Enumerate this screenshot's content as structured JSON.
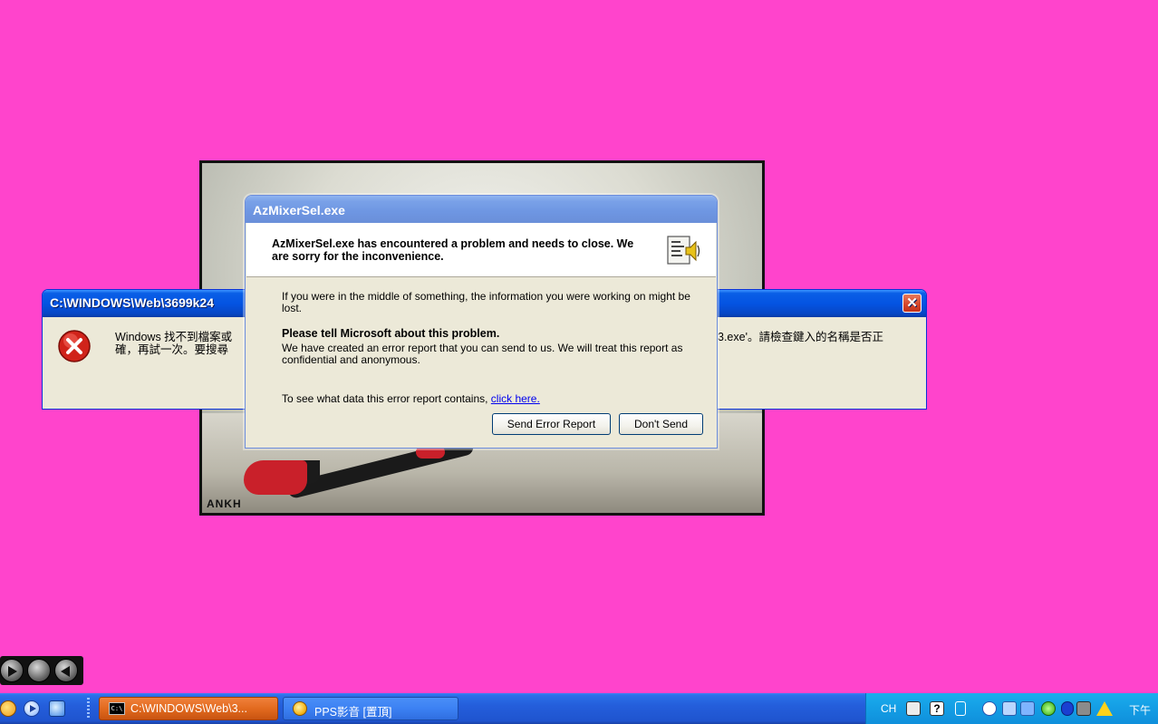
{
  "wallpaper": {
    "signature": "ANKH"
  },
  "windows_dialog": {
    "title": "C:\\WINDOWS\\Web\\3699k24",
    "message_left": "Windows 找不到檔案或",
    "message_left_line2": "確，再試一次。要搜尋",
    "message_right": "3.exe'。請檢查鍵入的名稱是否正",
    "close_glyph": "✕"
  },
  "error_dialog": {
    "title": "AzMixerSel.exe",
    "header": "AzMixerSel.exe has encountered a problem and needs to close.  We are sorry for the inconvenience.",
    "info": "If you were in the middle of something, the information you were working on might be lost.",
    "tell_heading": "Please tell Microsoft about this problem.",
    "report_text": "We have created an error report that you can send to us.  We will treat this report as confidential and anonymous.",
    "see_data_prefix": "To see what data this error report contains, ",
    "see_data_link": "click here.",
    "send_button": "Send Error Report",
    "dont_send_button": "Don't Send"
  },
  "taskbar": {
    "tasks": [
      {
        "label": "C:\\WINDOWS\\Web\\3...",
        "icon": "cmd-icon",
        "active": true
      },
      {
        "label": "PPS影音 [置頂]",
        "icon": "pps-icon",
        "active": false
      }
    ],
    "cmd_icon_text": "C:\\",
    "tray": {
      "language": "CH",
      "help_glyph": "?",
      "clock": "下午"
    }
  },
  "colors": {
    "desktop": "#ff44cc",
    "xp_blue_title": "#0454e2",
    "inactive_title": "#7aa1e8",
    "active_task": "#e26a1f",
    "dialog_bg": "#ece9d8"
  }
}
